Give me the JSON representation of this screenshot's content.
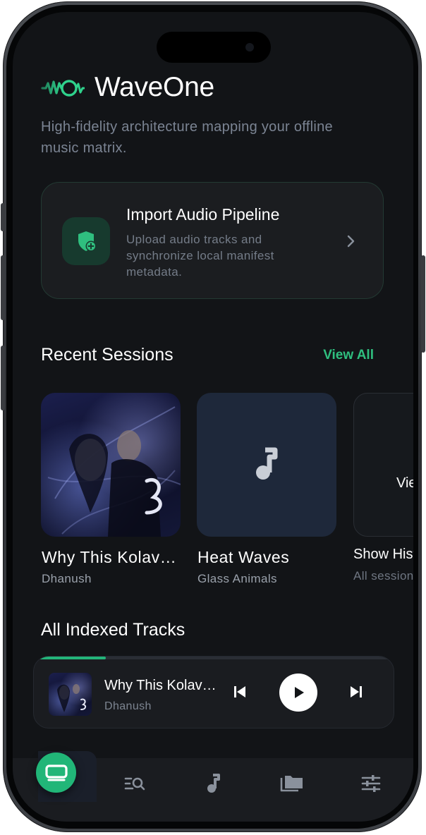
{
  "app": {
    "title": "WaveOne",
    "tagline": "High-fidelity architecture mapping your offline music matrix."
  },
  "import_card": {
    "title": "Import Audio Pipeline",
    "description": "Upload audio tracks and synchronize local manifest metadata.",
    "icon": "shield-plus-icon"
  },
  "recent": {
    "heading": "Recent Sessions",
    "view_all": "View All",
    "items": [
      {
        "title": "Why This Kolaveri Di",
        "subtitle": "Dhanush",
        "art": "album-art"
      },
      {
        "title": "Heat Waves",
        "subtitle": "Glass Animals",
        "art": "music-note-icon"
      },
      {
        "title": "Show History",
        "subtitle": "All sessions",
        "label": "View All"
      }
    ]
  },
  "tracks": {
    "heading": "All Indexed Tracks"
  },
  "player": {
    "title": "Why This Kolaveri Di",
    "artist": "Dhanush",
    "progress": 0.2
  },
  "nav": {
    "items": [
      "home-icon",
      "search-list-icon",
      "music-note-icon",
      "folder-icon",
      "sliders-icon"
    ],
    "active": 0
  },
  "colors": {
    "accent": "#23b57a",
    "background": "#121417",
    "card": "#1b1d20"
  }
}
